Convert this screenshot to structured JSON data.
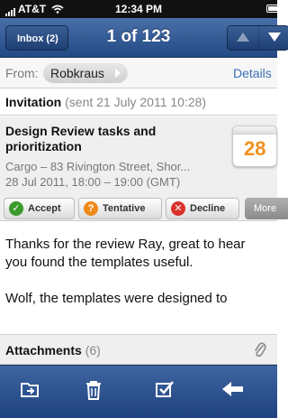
{
  "status": {
    "carrier": "AT&T",
    "time": "12:34 PM"
  },
  "nav": {
    "back_label": "Inbox (2)",
    "title": "1 of 123"
  },
  "from": {
    "label": "From:",
    "sender": "Robkraus",
    "details_link": "Details"
  },
  "subject": {
    "title": "Invitation",
    "sent": "(sent 21 July 2011 10:28)"
  },
  "invitation": {
    "title": "Design Review tasks and prioritization",
    "location": "Cargo – 83 Rivington Street, Shor...",
    "time": "28 Jul 2011, 18:00 – 19:00 (GMT)",
    "calendar_day": "28",
    "actions": {
      "accept": "Accept",
      "tentative": "Tentative",
      "decline": "Decline",
      "more": "More"
    }
  },
  "body": {
    "paragraphs": [
      "Thanks for the review Ray, great to hear",
      "you found the templates useful.",
      "Wolf, the templates were designed to"
    ]
  },
  "attachments": {
    "label": "Attachments",
    "count": "(6)"
  },
  "toolbar": {
    "icons": [
      "folder-move-icon",
      "trash-icon",
      "mark-icon",
      "reply-icon"
    ]
  },
  "colors": {
    "nav_blue": "#234a85",
    "link_blue": "#3b6fb6",
    "accent_orange": "#f0921c",
    "accept_green": "#3a9a2c",
    "decline_red": "#d9332b"
  }
}
